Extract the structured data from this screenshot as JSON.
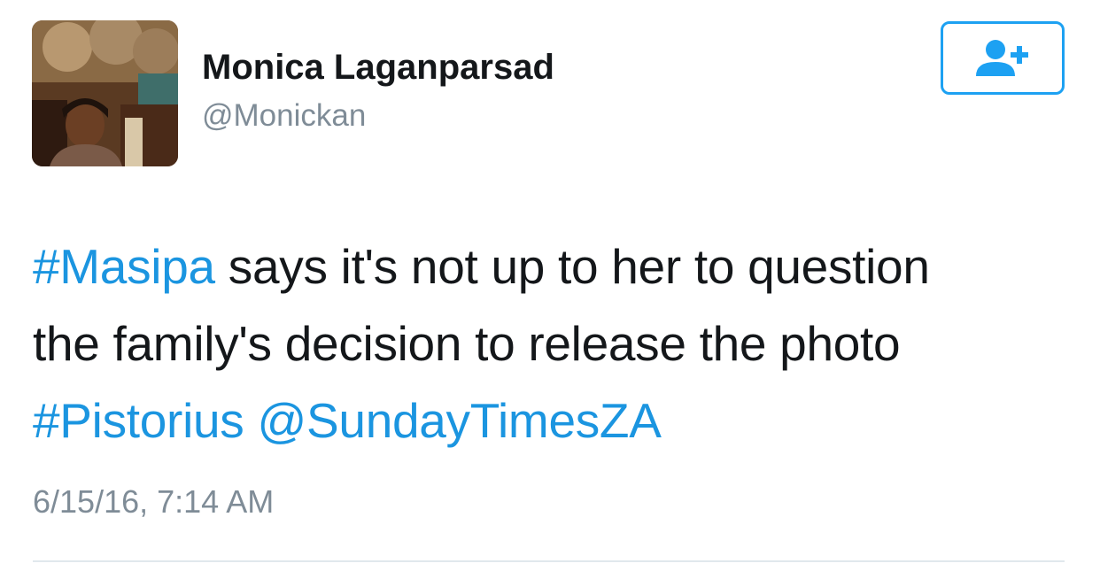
{
  "user": {
    "display_name": "Monica Laganparsad",
    "handle": "@Monickan",
    "avatar_icon": "profile-photo"
  },
  "follow_button": {
    "icon": "add-user-icon",
    "color": "#1da1f2"
  },
  "tweet": {
    "segments": [
      {
        "text": "#Masipa",
        "type": "hashtag"
      },
      {
        "text": " says it's not up to her to question",
        "type": "text"
      },
      {
        "text": "the family's decision to release the photo",
        "type": "text"
      },
      {
        "text": "#Pistorius",
        "type": "hashtag"
      },
      {
        "text": " ",
        "type": "text"
      },
      {
        "text": "@SundayTimesZA",
        "type": "mention"
      }
    ],
    "timestamp": "6/15/16, 7:14 AM"
  },
  "colors": {
    "link": "#1b95e0",
    "text": "#14171a",
    "secondary": "#7f8c97",
    "divider": "#e1e8ed"
  }
}
